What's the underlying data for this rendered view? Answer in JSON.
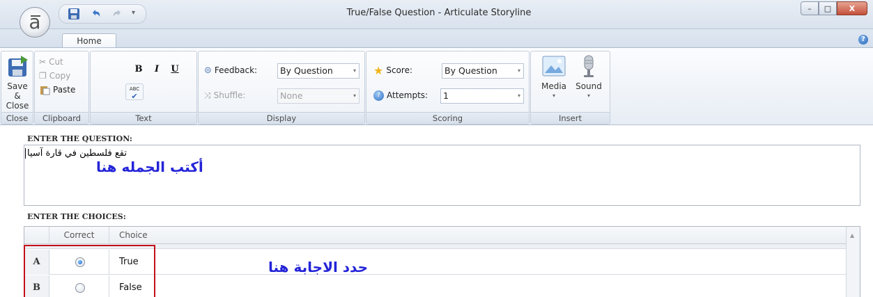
{
  "window": {
    "title": "True/False Question - Articulate Storyline",
    "app_letter": "a",
    "controls": {
      "minimize": "–",
      "maximize": "□",
      "close": "X"
    }
  },
  "quick_access": {
    "more": "▾"
  },
  "tabs": [
    {
      "label": "Home",
      "active": true
    }
  ],
  "help": {
    "glyph": "?"
  },
  "ribbon": {
    "close": {
      "save_close_line1": "Save &",
      "save_close_line2": "Close",
      "group_label": "Close"
    },
    "clipboard": {
      "cut": "Cut",
      "copy": "Copy",
      "paste": "Paste",
      "group_label": "Clipboard"
    },
    "text": {
      "bold": "B",
      "italic": "I",
      "underline": "U",
      "spell": "ABC",
      "group_label": "Text"
    },
    "display": {
      "feedback_label": "Feedback:",
      "feedback_value": "By Question",
      "shuffle_label": "Shuffle:",
      "shuffle_value": "None",
      "group_label": "Display"
    },
    "scoring": {
      "score_label": "Score:",
      "score_value": "By Question",
      "attempts_label": "Attempts:",
      "attempts_value": "1",
      "group_label": "Scoring"
    },
    "insert": {
      "media": "Media",
      "sound": "Sound",
      "group_label": "Insert"
    }
  },
  "question": {
    "section_label": "ENTER THE QUESTION:",
    "text": "تقع فلسطين في قارة آسيا",
    "annotation": "أكتب الجمله هنا"
  },
  "choices": {
    "section_label": "ENTER THE CHOICES:",
    "headers": {
      "correct": "Correct",
      "choice": "Choice"
    },
    "rows": [
      {
        "letter": "A",
        "text": "True",
        "checked": true
      },
      {
        "letter": "B",
        "text": "False",
        "checked": false
      }
    ],
    "annotation": "حدد الاجابة هنا"
  },
  "colors": {
    "annotation": "#2424d8",
    "highlight_box": "#c4101a",
    "accent": "#2563b8"
  }
}
